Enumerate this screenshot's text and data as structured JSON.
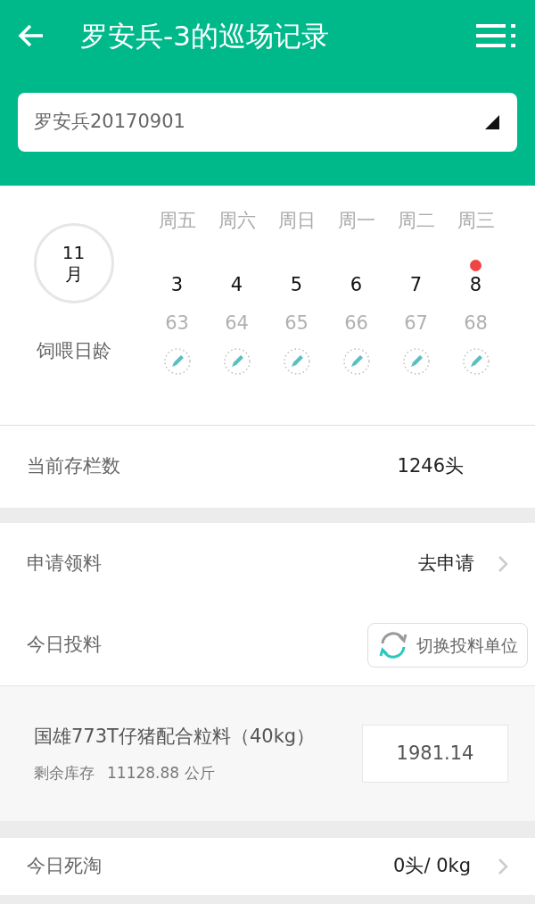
{
  "header": {
    "title": "罗安兵-3的巡场记录"
  },
  "batch_select": {
    "value": "罗安兵20170901"
  },
  "calendar": {
    "month": [
      "11",
      "月"
    ],
    "age_label": "饲喂日龄",
    "days": [
      {
        "weekday": "周五",
        "date": "3",
        "age": "63",
        "marked": false
      },
      {
        "weekday": "周六",
        "date": "4",
        "age": "64",
        "marked": false
      },
      {
        "weekday": "周日",
        "date": "5",
        "age": "65",
        "marked": false
      },
      {
        "weekday": "周一",
        "date": "6",
        "age": "66",
        "marked": false
      },
      {
        "weekday": "周二",
        "date": "7",
        "age": "67",
        "marked": false
      },
      {
        "weekday": "周三",
        "date": "8",
        "age": "68",
        "marked": true
      }
    ]
  },
  "stock": {
    "label": "当前存栏数",
    "value": "1246头"
  },
  "apply": {
    "label": "申请领料",
    "action": "去申请"
  },
  "feed": {
    "label": "今日投料",
    "switch_button": "切换投料单位",
    "items": [
      {
        "name": "国雄773T仔猪配合粒料（40kg）",
        "stock_label": "剩余库存",
        "stock_value": "11128.88",
        "stock_unit": "公斤",
        "amount": "1981.14"
      }
    ]
  },
  "death": {
    "label": "今日死淘",
    "value": "0头/ 0kg"
  }
}
